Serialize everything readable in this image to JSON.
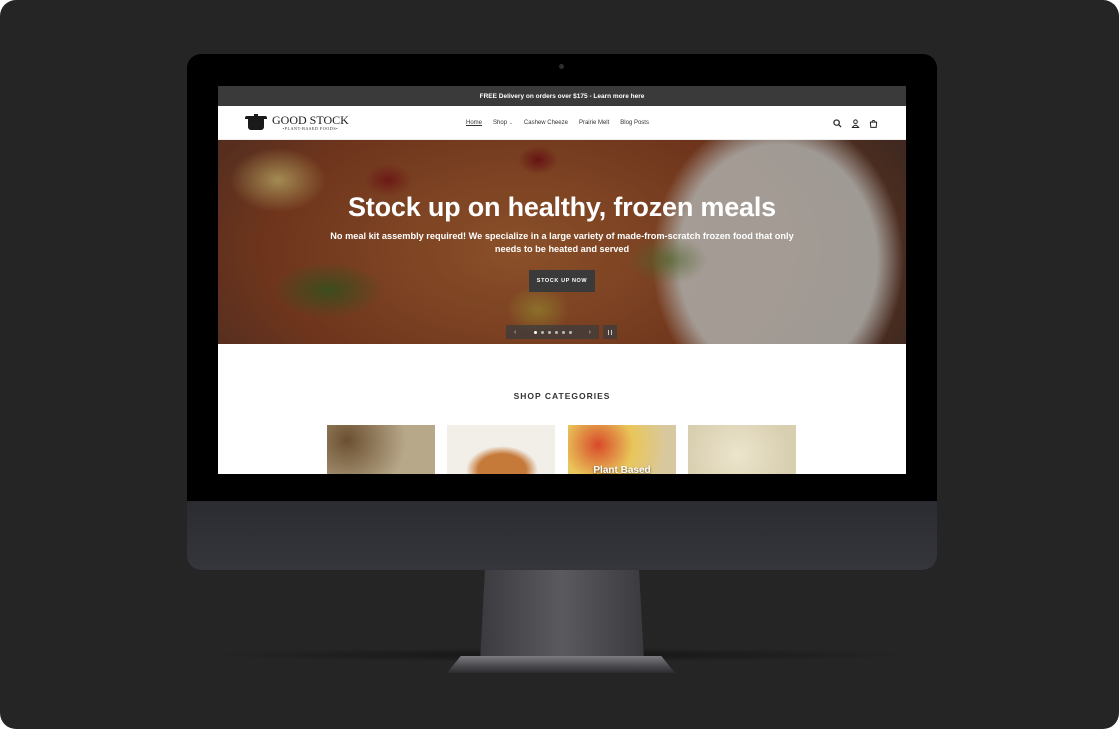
{
  "announcement": "FREE Delivery on orders over $175 - Learn more here",
  "brand": {
    "name": "GOOD STOCK",
    "tagline": "•PLANT-BASED FOODS•"
  },
  "nav": {
    "items": [
      {
        "label": "Home",
        "active": true
      },
      {
        "label": "Shop",
        "caret": "⌄"
      },
      {
        "label": "Cashew Cheeze"
      },
      {
        "label": "Prairie Melt"
      },
      {
        "label": "Blog Posts"
      }
    ]
  },
  "header_icons": [
    "search-icon",
    "account-icon",
    "cart-icon"
  ],
  "hero": {
    "title": "Stock up on healthy, frozen meals",
    "subtitle": "No meal kit assembly required! We specialize in a large variety of made-from-scratch frozen food that only needs to be heated and served",
    "cta": "STOCK UP NOW",
    "slider": {
      "prev": "‹",
      "next": "›",
      "slide_count": 6,
      "current_slide": 1
    }
  },
  "categories": {
    "heading": "SHOP CATEGORIES",
    "items": [
      {
        "label": ""
      },
      {
        "label": ""
      },
      {
        "label": "Plant Based"
      },
      {
        "label": ""
      }
    ]
  },
  "colors": {
    "announcement_bg": "#3a3a3a",
    "button_bg": "#3a3a3a",
    "text": "#333333",
    "backdrop": "#252525"
  }
}
